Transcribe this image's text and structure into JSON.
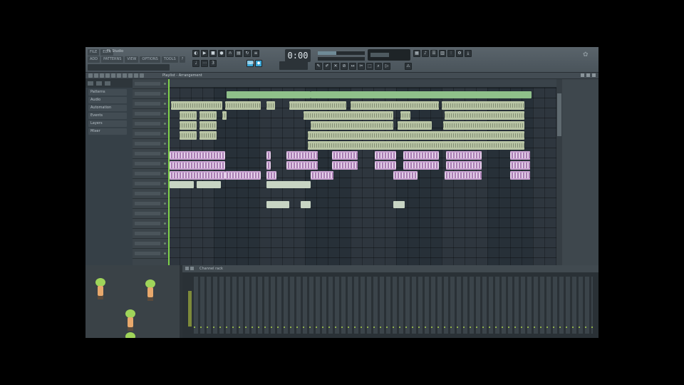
{
  "toolbar": {
    "title": "FL Studio",
    "menus": [
      "FILE",
      "EDIT",
      "ADD",
      "PATTERNS",
      "VIEW",
      "OPTIONS",
      "TOOLS",
      "?"
    ],
    "hint": "",
    "time": "0:00",
    "tempo": "",
    "news": "",
    "transport_icons": [
      "pattern-song-toggle",
      "play-icon",
      "stop-icon",
      "record-icon"
    ]
  },
  "playlist": {
    "title": "Playlist - Arrangement",
    "picker_items": [
      "Patterns",
      "Audio",
      "Automation",
      "Events",
      "Layers",
      "Mixer"
    ]
  },
  "mixer": {
    "labels": [
      "",
      "",
      "",
      "",
      "",
      "",
      ""
    ]
  },
  "channel_rack": {
    "title": "Channel rack"
  },
  "colors": {
    "playhead": "#7fd24a",
    "pattern_clip": "#b9c5a5",
    "audio_clip": "#caa3d2",
    "automation_clip": "#8fc08a",
    "accent_blue": "#3aa7d8"
  }
}
